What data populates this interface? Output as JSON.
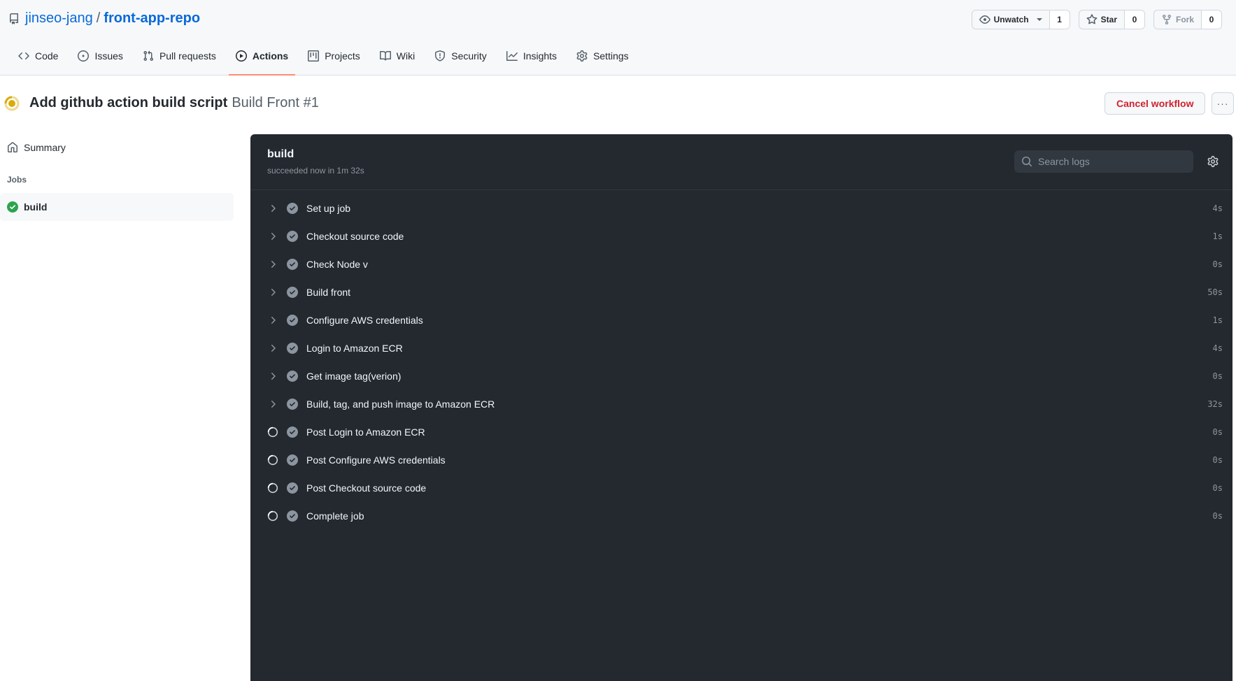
{
  "repo": {
    "owner": "jinseo-jang",
    "separator": "/",
    "name": "front-app-repo"
  },
  "repo_actions": {
    "watch": {
      "label": "Unwatch",
      "count": "1"
    },
    "star": {
      "label": "Star",
      "count": "0"
    },
    "fork": {
      "label": "Fork",
      "count": "0"
    }
  },
  "tabs": [
    {
      "label": "Code",
      "icon": "code-icon"
    },
    {
      "label": "Issues",
      "icon": "issue-icon"
    },
    {
      "label": "Pull requests",
      "icon": "pull-request-icon"
    },
    {
      "label": "Actions",
      "icon": "play-icon",
      "active": true
    },
    {
      "label": "Projects",
      "icon": "project-icon"
    },
    {
      "label": "Wiki",
      "icon": "book-icon"
    },
    {
      "label": "Security",
      "icon": "shield-icon"
    },
    {
      "label": "Insights",
      "icon": "graph-icon"
    },
    {
      "label": "Settings",
      "icon": "gear-icon"
    }
  ],
  "run": {
    "status": "in_progress",
    "status_color": "#dbab0a",
    "commit_title": "Add github action build script",
    "workflow_label": "Build Front #1",
    "cancel_label": "Cancel workflow",
    "more_label": "···"
  },
  "sidebar": {
    "summary_label": "Summary",
    "jobs_label": "Jobs",
    "jobs": [
      {
        "label": "build",
        "status": "success",
        "status_color": "#2da44e"
      }
    ]
  },
  "log": {
    "job_name": "build",
    "job_meta": "succeeded now in 1m 32s",
    "search_placeholder": "Search logs",
    "steps": [
      {
        "label": "Set up job",
        "duration": "4s",
        "state": "collapsed"
      },
      {
        "label": "Checkout source code",
        "duration": "1s",
        "state": "collapsed"
      },
      {
        "label": "Check Node v",
        "duration": "0s",
        "state": "collapsed"
      },
      {
        "label": "Build front",
        "duration": "50s",
        "state": "collapsed"
      },
      {
        "label": "Configure AWS credentials",
        "duration": "1s",
        "state": "collapsed"
      },
      {
        "label": "Login to Amazon ECR",
        "duration": "4s",
        "state": "collapsed"
      },
      {
        "label": "Get image tag(verion)",
        "duration": "0s",
        "state": "collapsed"
      },
      {
        "label": "Build, tag, and push image to Amazon ECR",
        "duration": "32s",
        "state": "collapsed"
      },
      {
        "label": "Post Login to Amazon ECR",
        "duration": "0s",
        "state": "loading"
      },
      {
        "label": "Post Configure AWS credentials",
        "duration": "0s",
        "state": "loading"
      },
      {
        "label": "Post Checkout source code",
        "duration": "0s",
        "state": "loading"
      },
      {
        "label": "Complete job",
        "duration": "0s",
        "state": "loading"
      }
    ]
  }
}
